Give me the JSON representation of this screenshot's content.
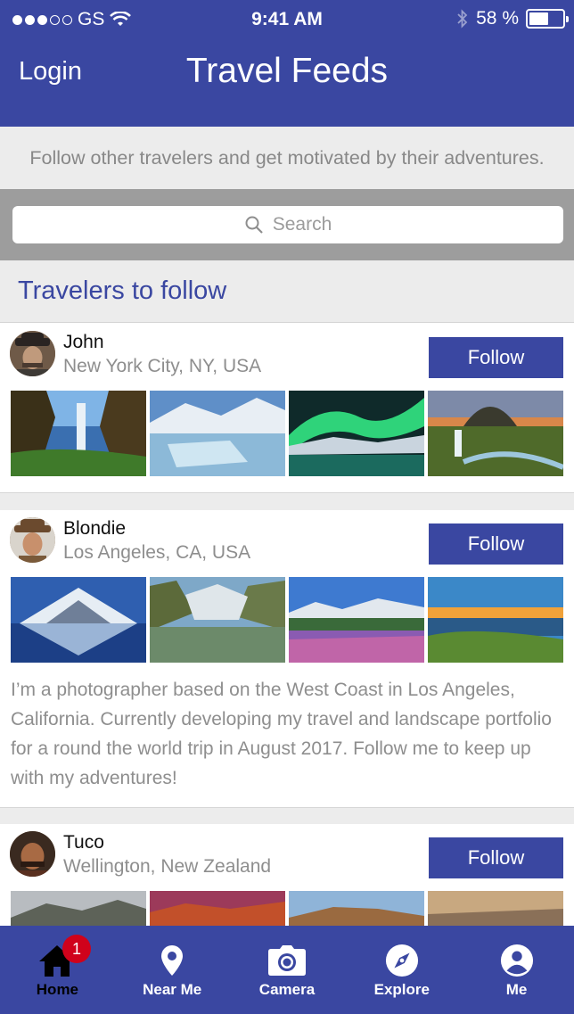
{
  "status_bar": {
    "carrier": "GS",
    "time": "9:41 AM",
    "battery": "58 %",
    "battery_level": 0.58
  },
  "nav": {
    "login_label": "Login",
    "title": "Travel Feeds"
  },
  "subtitle": "Follow other travelers and get motivated by their adventures.",
  "search": {
    "placeholder": "Search"
  },
  "section_title": "Travelers to follow",
  "travelers": [
    {
      "name": "John",
      "location": "New York City, NY, USA",
      "follow_label": "Follow"
    },
    {
      "name": "Blondie",
      "location": "Los Angeles, CA, USA",
      "follow_label": "Follow",
      "bio": "I’m a photographer based on the West Coast in Los Angeles, California. Currently developing my travel and landscape portfolio for a round the world trip in August 2017. Follow me to keep up with my adventures!"
    },
    {
      "name": "Tuco",
      "location": "Wellington, New Zealand",
      "follow_label": "Follow"
    }
  ],
  "tabs": [
    {
      "label": "Home",
      "icon": "home-icon",
      "badge": "1",
      "active": true
    },
    {
      "label": "Near Me",
      "icon": "location-pin-icon"
    },
    {
      "label": "Camera",
      "icon": "camera-icon"
    },
    {
      "label": "Explore",
      "icon": "compass-icon"
    },
    {
      "label": "Me",
      "icon": "user-icon"
    }
  ],
  "colors": {
    "brand": "#3a47a1",
    "badge": "#d0021b",
    "muted_text": "#8e8e8e",
    "background": "#ececec"
  }
}
